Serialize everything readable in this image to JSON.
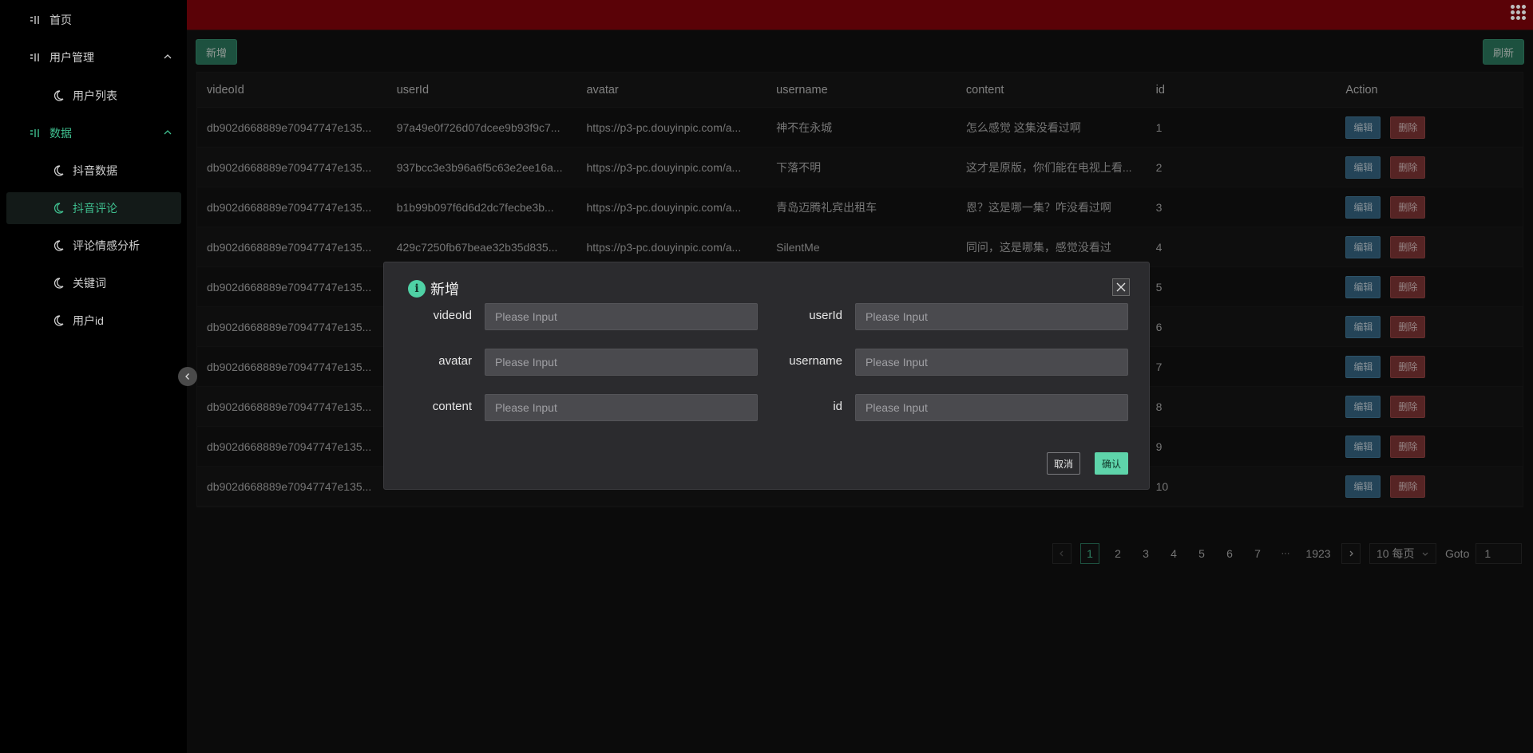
{
  "sidebar": {
    "items": [
      {
        "label": "首页",
        "icon": "sidebar-glyph-icon"
      },
      {
        "label": "用户管理",
        "icon": "sidebar-glyph-icon"
      },
      {
        "label": "用户列表",
        "icon": "moon-icon"
      },
      {
        "label": "数据",
        "icon": "sidebar-glyph-icon"
      },
      {
        "label": "抖音数据",
        "icon": "moon-icon"
      },
      {
        "label": "抖音评论",
        "icon": "moon-icon"
      },
      {
        "label": "评论情感分析",
        "icon": "moon-icon"
      },
      {
        "label": "关键词",
        "icon": "moon-icon"
      },
      {
        "label": "用户id",
        "icon": "moon-icon"
      }
    ],
    "accent": "#3fbf8f"
  },
  "toolbar": {
    "add_label": "新增",
    "refresh_label": "刷新"
  },
  "table": {
    "headers": [
      "videoId",
      "userId",
      "avatar",
      "username",
      "content",
      "id",
      "Action"
    ],
    "rows": [
      {
        "videoId": "db902d668889e70947747e135...",
        "userId": "97a49e0f726d07dcee9b93f9c7...",
        "avatar": "https://p3-pc.douyinpic.com/a...",
        "username": "神不在永城",
        "content": "怎么感觉 这集没看过啊",
        "id": "1"
      },
      {
        "videoId": "db902d668889e70947747e135...",
        "userId": "937bcc3e3b96a6f5c63e2ee16a...",
        "avatar": "https://p3-pc.douyinpic.com/a...",
        "username": "下落不明",
        "content": "这才是原版，你们能在电视上看...",
        "id": "2"
      },
      {
        "videoId": "db902d668889e70947747e135...",
        "userId": "b1b99b097f6d6d2dc7fecbe3b...",
        "avatar": "https://p3-pc.douyinpic.com/a...",
        "username": "青岛迈腾礼宾出租车",
        "content": "恩？这是哪一集？咋没看过啊",
        "id": "3"
      },
      {
        "videoId": "db902d668889e70947747e135...",
        "userId": "429c7250fb67beae32b35d835...",
        "avatar": "https://p3-pc.douyinpic.com/a...",
        "username": "SilentMe",
        "content": "同问，这是哪集，感觉没看过",
        "id": "4"
      },
      {
        "videoId": "db902d668889e70947747e135...",
        "userId": "",
        "avatar": "",
        "username": "",
        "content": "",
        "id": "5"
      },
      {
        "videoId": "db902d668889e70947747e135...",
        "userId": "",
        "avatar": "",
        "username": "",
        "content": "",
        "id": "6"
      },
      {
        "videoId": "db902d668889e70947747e135...",
        "userId": "",
        "avatar": "",
        "username": "",
        "content": "",
        "id": "7"
      },
      {
        "videoId": "db902d668889e70947747e135...",
        "userId": "",
        "avatar": "",
        "username": "",
        "content": "",
        "id": "8"
      },
      {
        "videoId": "db902d668889e70947747e135...",
        "userId": "",
        "avatar": "",
        "username": "",
        "content": "",
        "id": "9"
      },
      {
        "videoId": "db902d668889e70947747e135...",
        "userId": "",
        "avatar": "",
        "username": "",
        "content": "",
        "id": "10"
      }
    ],
    "edit_label": "编辑",
    "delete_label": "删除"
  },
  "pagination": {
    "pages": [
      "1",
      "2",
      "3",
      "4",
      "5",
      "6",
      "7",
      "···",
      "1923"
    ],
    "current": "1",
    "page_size_label": "10 每页",
    "goto_label": "Goto",
    "goto_value": "1"
  },
  "modal": {
    "title": "新增",
    "fields": [
      {
        "label": "videoId",
        "placeholder": "Please Input"
      },
      {
        "label": "userId",
        "placeholder": "Please Input"
      },
      {
        "label": "avatar",
        "placeholder": "Please Input"
      },
      {
        "label": "username",
        "placeholder": "Please Input"
      },
      {
        "label": "content",
        "placeholder": "Please Input"
      },
      {
        "label": "id",
        "placeholder": "Please Input"
      }
    ],
    "cancel_label": "取消",
    "confirm_label": "确认"
  }
}
